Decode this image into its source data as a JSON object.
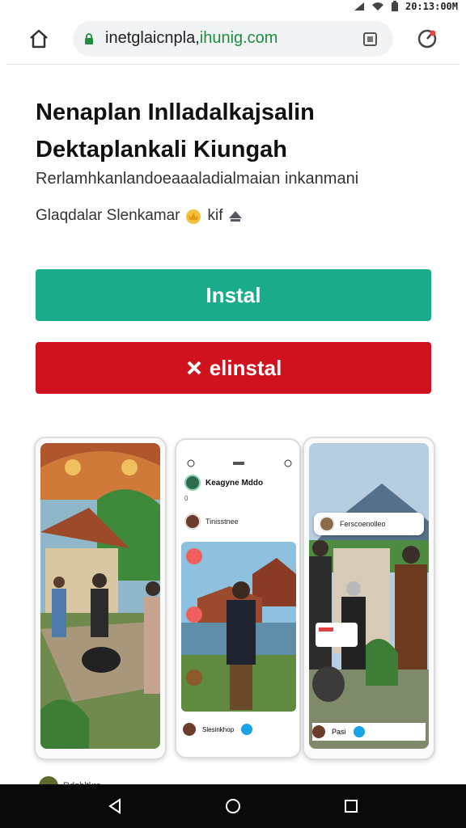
{
  "status_bar": {
    "time": "20:13:00M"
  },
  "browser": {
    "url_path": "inetglaicnpla,",
    "url_host": "ihunig.com"
  },
  "app": {
    "title": "Nenaplan Inlladalkajsalin Dektaplankali Kiungah",
    "subtitle": "Rerlamhkanlandoeaaaladialmaian inkanmani",
    "developer": "Glaqdalar Slenkamar",
    "developer_suffix": "kif",
    "install_label": "Instal",
    "uninstall_label": "elinstal"
  },
  "screenshots": {
    "phone2_name": "Keagyne Mddo",
    "phone2_sub": "0",
    "phone2_row": "Tinisstnee",
    "phone2_footer": "Slesinkhop",
    "phone3_card": "Ferscoenolleo",
    "phone3_footer": "Pasi"
  },
  "partial_row": {
    "label": "Rdgbltkrs"
  },
  "colors": {
    "install": "#1aab8a",
    "uninstall": "#d0121f",
    "url_host": "#1e8e3e"
  }
}
